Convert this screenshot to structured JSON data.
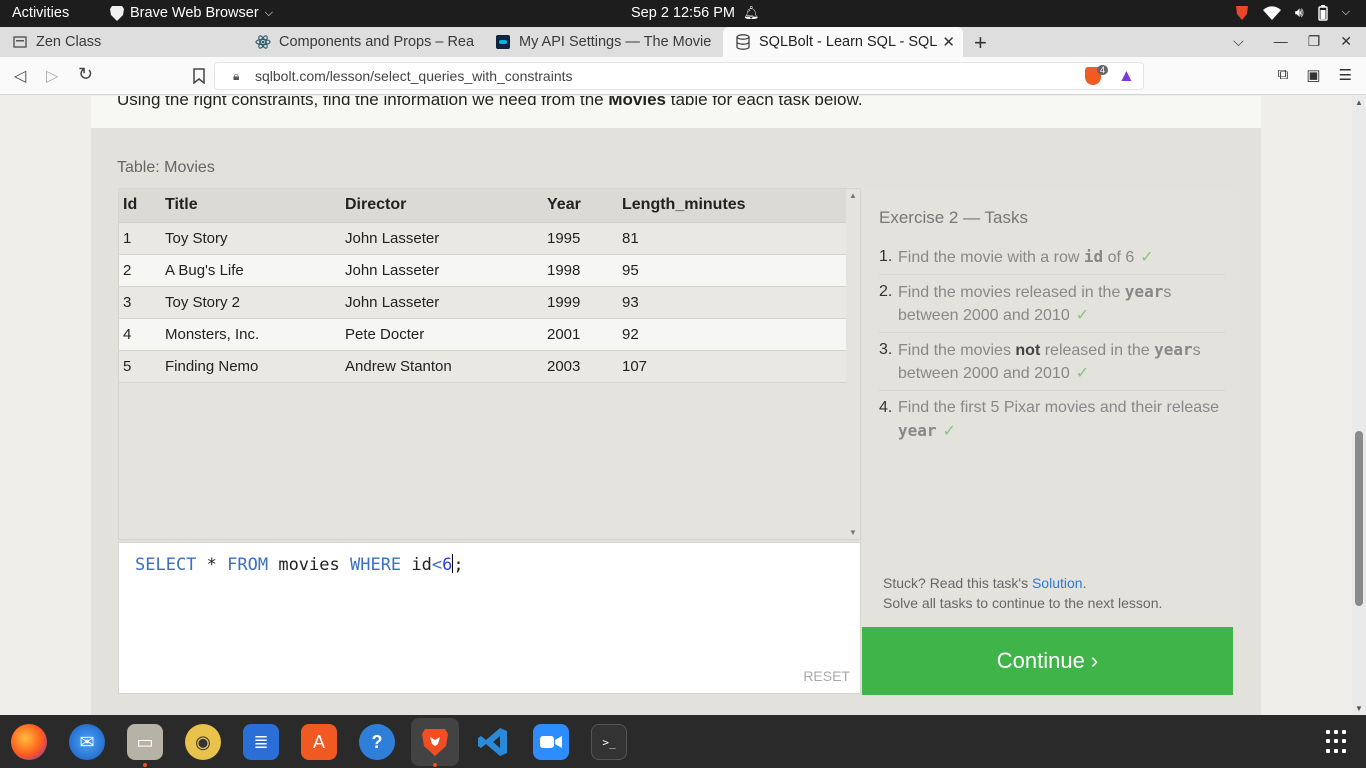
{
  "topbar": {
    "activities": "Activities",
    "app_name": "Brave Web Browser",
    "clock": "Sep 2  12:56 PM"
  },
  "tabs": [
    {
      "title": "Zen Class",
      "icon": "window-icon"
    },
    {
      "title": "Components and Props – Rea",
      "icon": "react-icon"
    },
    {
      "title": "My API Settings — The Movie",
      "icon": "tmdb-icon"
    },
    {
      "title": "SQLBolt - Learn SQL - SQL",
      "icon": "db-icon",
      "active": true
    }
  ],
  "address_bar": {
    "url": "sqlbolt.com/lesson/select_queries_with_constraints",
    "shield_count": "4"
  },
  "lesson": {
    "intro_pre": "Using the right constraints, find the information we need from the ",
    "intro_bold": "Movies",
    "intro_post": " table for each task below.",
    "table_caption": "Table: Movies",
    "columns": [
      "Id",
      "Title",
      "Director",
      "Year",
      "Length_minutes"
    ],
    "rows": [
      [
        "1",
        "Toy Story",
        "John Lasseter",
        "1995",
        "81"
      ],
      [
        "2",
        "A Bug's Life",
        "John Lasseter",
        "1998",
        "95"
      ],
      [
        "3",
        "Toy Story 2",
        "John Lasseter",
        "1999",
        "93"
      ],
      [
        "4",
        "Monsters, Inc.",
        "Pete Docter",
        "2001",
        "92"
      ],
      [
        "5",
        "Finding Nemo",
        "Andrew Stanton",
        "2003",
        "107"
      ]
    ]
  },
  "editor": {
    "kw_select": "SELECT",
    "star": " * ",
    "kw_from": "FROM",
    "table": " movies ",
    "kw_where": "WHERE",
    "col": " id",
    "op": "<",
    "value": "6",
    "semi": ";",
    "reset_label": "RESET"
  },
  "exercise": {
    "title": "Exercise 2 — Tasks",
    "tasks": [
      {
        "num": "1.",
        "pre": "Find the movie with a row ",
        "code": "id",
        "post": " of 6",
        "done": "✓"
      },
      {
        "num": "2.",
        "pre": "Find the movies released in the ",
        "code": "year",
        "post": "s between 2000 and 2010",
        "done": "✓"
      },
      {
        "num": "3.",
        "pre": "Find the movies ",
        "bold": "not",
        "mid": " released in the ",
        "code": "year",
        "post": "s between 2000 and 2010",
        "done": "✓"
      },
      {
        "num": "4.",
        "pre": "Find the first 5 Pixar movies and their release ",
        "code": "year",
        "post": "",
        "done": "✓"
      }
    ],
    "stuck_pre": "Stuck? Read this task's ",
    "stuck_link": "Solution",
    "stuck_post": ".",
    "solve_all": "Solve all tasks to continue to the next lesson.",
    "continue_label": "Continue ›"
  }
}
